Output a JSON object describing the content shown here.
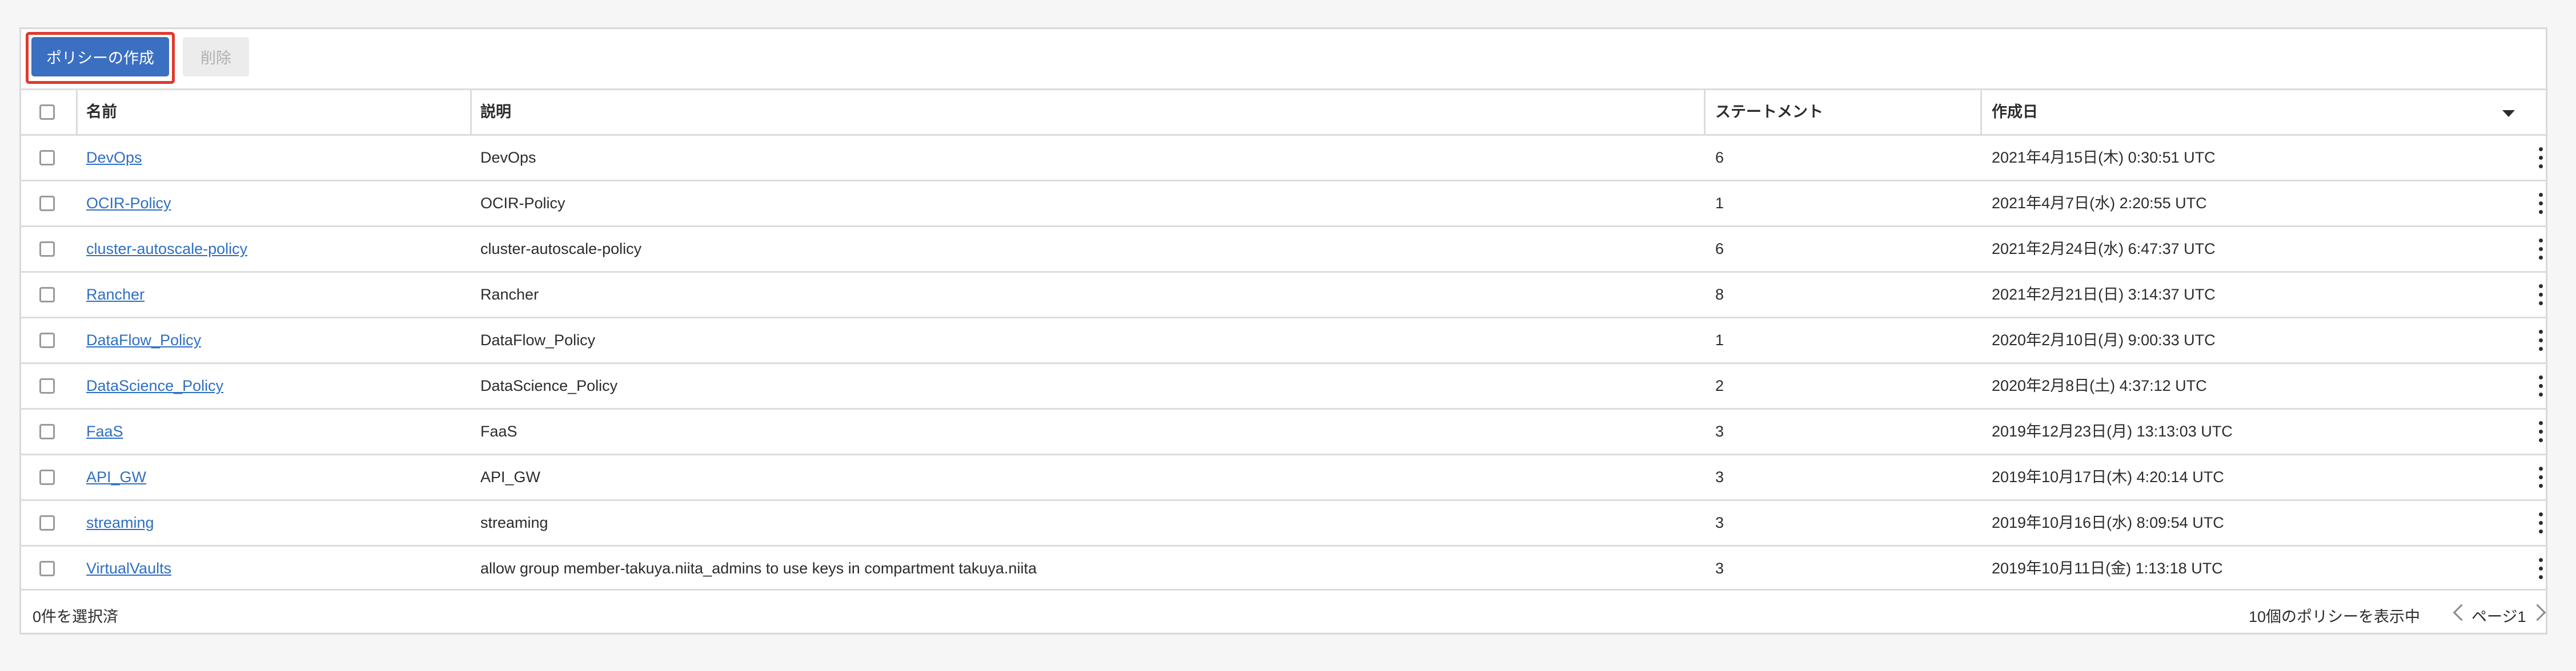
{
  "toolbar": {
    "create_label": "ポリシーの作成",
    "delete_label": "削除",
    "highlight_color": "#e03a2f",
    "primary_color": "#3a6fc1"
  },
  "table": {
    "columns": {
      "name": "名前",
      "description": "説明",
      "statements": "ステートメント",
      "created": "作成日"
    },
    "rows": [
      {
        "name": "DevOps",
        "description": "DevOps",
        "statements": "6",
        "created": "2021年4月15日(木) 0:30:51 UTC"
      },
      {
        "name": "OCIR-Policy",
        "description": "OCIR-Policy",
        "statements": "1",
        "created": "2021年4月7日(水) 2:20:55 UTC"
      },
      {
        "name": "cluster-autoscale-policy",
        "description": "cluster-autoscale-policy",
        "statements": "6",
        "created": "2021年2月24日(水) 6:47:37 UTC"
      },
      {
        "name": "Rancher",
        "description": "Rancher",
        "statements": "8",
        "created": "2021年2月21日(日) 3:14:37 UTC"
      },
      {
        "name": "DataFlow_Policy",
        "description": "DataFlow_Policy",
        "statements": "1",
        "created": "2020年2月10日(月) 9:00:33 UTC"
      },
      {
        "name": "DataScience_Policy",
        "description": "DataScience_Policy",
        "statements": "2",
        "created": "2020年2月8日(土) 4:37:12 UTC"
      },
      {
        "name": "FaaS",
        "description": "FaaS",
        "statements": "3",
        "created": "2019年12月23日(月) 13:13:03 UTC"
      },
      {
        "name": "API_GW",
        "description": "API_GW",
        "statements": "3",
        "created": "2019年10月17日(木) 4:20:14 UTC"
      },
      {
        "name": "streaming",
        "description": "streaming",
        "statements": "3",
        "created": "2019年10月16日(水) 8:09:54 UTC"
      },
      {
        "name": "VirtualVaults",
        "description": "allow group member-takuya.niita_admins to use keys in compartment takuya.niita",
        "statements": "3",
        "created": "2019年10月11日(金) 1:13:18 UTC"
      }
    ]
  },
  "footer": {
    "selected": "0件を選択済",
    "count": "10個のポリシーを表示中",
    "page": "ページ1"
  },
  "icons": {
    "sort": "caret-down-icon",
    "row_actions": "kebab-menu-icon",
    "prev": "chevron-left-icon",
    "next": "chevron-right-icon"
  }
}
